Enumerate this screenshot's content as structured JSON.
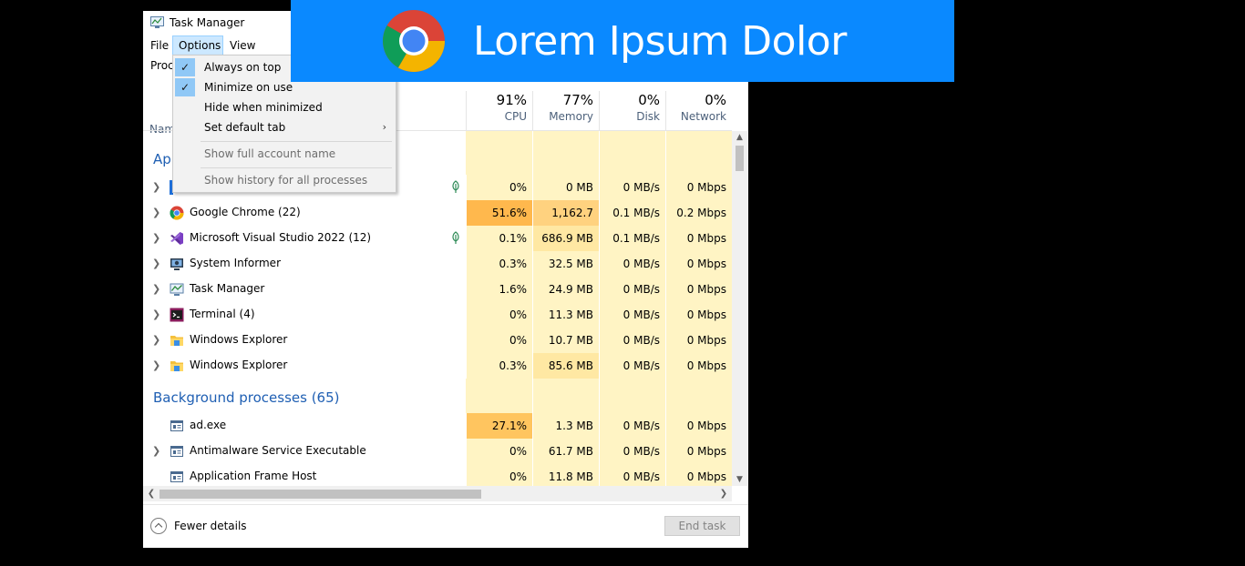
{
  "window": {
    "title": "Task Manager"
  },
  "menu": {
    "file": "File",
    "options": "Options",
    "view": "View"
  },
  "tabs_label": "Proc",
  "options_menu": {
    "always_on_top": "Always on top",
    "minimize_on_use": "Minimize on use",
    "hide_when_minimized": "Hide when minimized",
    "set_default_tab": "Set default tab",
    "show_full_account_name": "Show full account name",
    "show_history": "Show history for all processes",
    "check_glyph": "✓",
    "submenu_glyph": "›"
  },
  "columns": {
    "name": "Nam",
    "cpu": {
      "pct": "91%",
      "label": "CPU"
    },
    "memory": {
      "pct": "77%",
      "label": "Memory"
    },
    "disk": {
      "pct": "0%",
      "label": "Disk"
    },
    "network": {
      "pct": "0%",
      "label": "Network"
    }
  },
  "groups": {
    "apps_partial": "App",
    "background": "Background processes (65)"
  },
  "apps": [
    {
      "name": "",
      "cpu": "0%",
      "mem": "0 MB",
      "disk": "0 MB/s",
      "net": "0 Mbps",
      "leaf": true,
      "icon": "app-icon"
    },
    {
      "name": "Google Chrome (22)",
      "cpu": "51.6%",
      "mem": "1,162.7 MB",
      "disk": "0.1 MB/s",
      "net": "0.2 Mbps",
      "icon": "chrome-icon"
    },
    {
      "name": "Microsoft Visual Studio 2022 (12)",
      "cpu": "0.1%",
      "mem": "686.9 MB",
      "disk": "0.1 MB/s",
      "net": "0 Mbps",
      "leaf": true,
      "icon": "visual-studio-icon"
    },
    {
      "name": "System Informer",
      "cpu": "0.3%",
      "mem": "32.5 MB",
      "disk": "0 MB/s",
      "net": "0 Mbps",
      "icon": "system-informer-icon"
    },
    {
      "name": "Task Manager",
      "cpu": "1.6%",
      "mem": "24.9 MB",
      "disk": "0 MB/s",
      "net": "0 Mbps",
      "icon": "task-manager-icon"
    },
    {
      "name": "Terminal (4)",
      "cpu": "0%",
      "mem": "11.3 MB",
      "disk": "0 MB/s",
      "net": "0 Mbps",
      "icon": "terminal-icon"
    },
    {
      "name": "Windows Explorer",
      "cpu": "0%",
      "mem": "10.7 MB",
      "disk": "0 MB/s",
      "net": "0 Mbps",
      "icon": "folder-icon"
    },
    {
      "name": "Windows Explorer",
      "cpu": "0.3%",
      "mem": "85.6 MB",
      "disk": "0 MB/s",
      "net": "0 Mbps",
      "icon": "folder-icon"
    }
  ],
  "background": [
    {
      "name": "ad.exe",
      "cpu": "27.1%",
      "mem": "1.3 MB",
      "disk": "0 MB/s",
      "net": "0 Mbps",
      "icon": "exe-icon",
      "expand": false
    },
    {
      "name": "Antimalware Service Executable",
      "cpu": "0%",
      "mem": "61.7 MB",
      "disk": "0 MB/s",
      "net": "0 Mbps",
      "icon": "exe-icon",
      "expand": true
    },
    {
      "name": "Application Frame Host",
      "cpu": "0%",
      "mem": "11.8 MB",
      "disk": "0 MB/s",
      "net": "0 Mbps",
      "icon": "exe-icon",
      "expand": false
    }
  ],
  "footer": {
    "fewer_details": "Fewer details",
    "end_task": "End task"
  },
  "banner": {
    "title": "Lorem Ipsum Dolor",
    "background_color": "#0a89ff"
  },
  "colors": {
    "heat_low": "#fff4c4",
    "heat_mid": "#ffe8a3",
    "heat_high": "#ffd27f",
    "heat_max": "#ffb84d",
    "group_blue": "#1f5fb3"
  }
}
